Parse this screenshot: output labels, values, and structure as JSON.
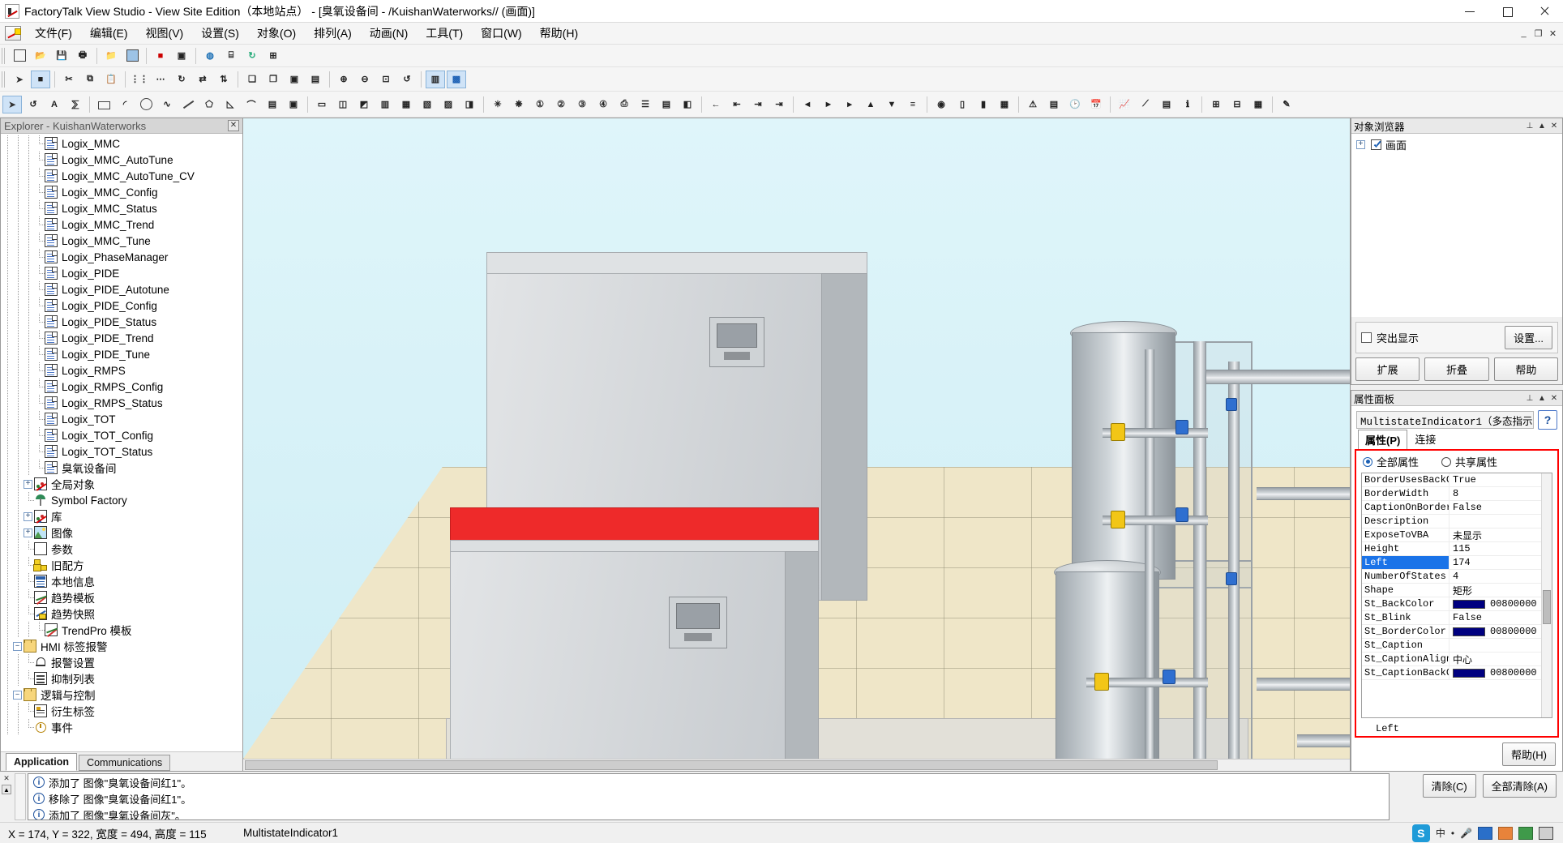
{
  "window": {
    "title": "FactoryTalk View Studio - View Site Edition（本地站点） - [臭氧设备间 - /KuishanWaterworks// (画面)]",
    "minimize": "–",
    "maximize": "□",
    "close": "✕"
  },
  "menu": {
    "items": [
      {
        "label": "文件(F)"
      },
      {
        "label": "编辑(E)"
      },
      {
        "label": "视图(V)"
      },
      {
        "label": "设置(S)"
      },
      {
        "label": "对象(O)"
      },
      {
        "label": "排列(A)"
      },
      {
        "label": "动画(N)"
      },
      {
        "label": "工具(T)"
      },
      {
        "label": "窗口(W)"
      },
      {
        "label": "帮助(H)"
      }
    ],
    "mdi": {
      "minimize": "_",
      "restore": "❐",
      "close": "✕"
    }
  },
  "toolbar_row1": [
    {
      "name": "new-display",
      "glyph": "▤"
    },
    {
      "name": "open-display",
      "glyph": "📂"
    },
    {
      "name": "save-display",
      "glyph": "💾"
    },
    {
      "name": "print",
      "glyph": "🖨"
    },
    {
      "name": "open-folder",
      "glyph": "📁"
    },
    {
      "name": "display-settings",
      "glyph": "▦"
    },
    {
      "name": "stop-test",
      "glyph": "■"
    },
    {
      "name": "test-run",
      "glyph": "▶"
    },
    {
      "name": "web-link",
      "glyph": "◍"
    },
    {
      "name": "tag-browser",
      "glyph": "⌸"
    },
    {
      "name": "refresh",
      "glyph": "↻"
    },
    {
      "name": "diagnostics",
      "glyph": "⊞"
    }
  ],
  "toolbar_row2": [
    {
      "name": "pointer-tool",
      "glyph": "➤"
    },
    {
      "name": "select-mode",
      "glyph": "■"
    },
    {
      "name": "cut",
      "glyph": "✂"
    },
    {
      "name": "copy",
      "glyph": "⧉"
    },
    {
      "name": "paste",
      "glyph": "📋"
    },
    {
      "name": "duplicate",
      "glyph": "⧉"
    },
    {
      "name": "align-grid",
      "glyph": "⋮⋮"
    },
    {
      "name": "snap-grid",
      "glyph": "⋯"
    },
    {
      "name": "rotate",
      "glyph": "↻"
    },
    {
      "name": "flip-horizontal",
      "glyph": "⇄"
    },
    {
      "name": "flip-vertical",
      "glyph": "⇅"
    },
    {
      "name": "group",
      "glyph": "❏"
    },
    {
      "name": "ungroup",
      "glyph": "❏"
    },
    {
      "name": "bring-front",
      "glyph": "▣"
    },
    {
      "name": "send-back",
      "glyph": "▤"
    },
    {
      "name": "zoom-in",
      "glyph": "⊕"
    },
    {
      "name": "zoom-out",
      "glyph": "⊖"
    },
    {
      "name": "zoom-fit",
      "glyph": "⊡"
    },
    {
      "name": "undo-arrange",
      "glyph": "↺"
    },
    {
      "name": "object-explorer",
      "glyph": "▥"
    },
    {
      "name": "property-panel",
      "glyph": "▩"
    }
  ],
  "toolbar_row3": [
    {
      "name": "select-arrow-tool",
      "glyph": "➤"
    },
    {
      "name": "rotate-tool",
      "glyph": "↺"
    },
    {
      "name": "text-tool",
      "glyph": "A"
    },
    {
      "name": "numeric-tool",
      "glyph": "⅀"
    },
    {
      "name": "rectangle-tool",
      "glyph": "▭"
    },
    {
      "name": "arc-tool",
      "glyph": "◜"
    },
    {
      "name": "ellipse-tool",
      "glyph": "◯"
    },
    {
      "name": "freehand-tool",
      "glyph": "∿"
    },
    {
      "name": "line-tool",
      "glyph": "╲"
    },
    {
      "name": "polygon-tool",
      "glyph": "⬠"
    },
    {
      "name": "wedge-tool",
      "glyph": "◺"
    },
    {
      "name": "polyline-tool",
      "glyph": "⌒"
    },
    {
      "name": "panel-tool",
      "glyph": "▤"
    },
    {
      "name": "image-tool",
      "glyph": "▣"
    },
    {
      "name": "button-tool",
      "glyph": "▭"
    },
    {
      "name": "toggle-tool",
      "glyph": "◫"
    },
    {
      "name": "multistate-tool",
      "glyph": "◩"
    },
    {
      "name": "latched-button",
      "glyph": "▥"
    },
    {
      "name": "interlock-button",
      "glyph": "▦"
    },
    {
      "name": "goto-display",
      "glyph": "▧"
    },
    {
      "name": "close-display",
      "glyph": "▨"
    },
    {
      "name": "ramp-tool",
      "glyph": "◨"
    },
    {
      "name": "indicator-tool",
      "glyph": "✳"
    },
    {
      "name": "symbol-tool",
      "glyph": "❋"
    },
    {
      "name": "numeric-display",
      "glyph": "1⃞"
    },
    {
      "name": "numeric-input",
      "glyph": "2⃞"
    },
    {
      "name": "string-display",
      "glyph": "3⃞"
    },
    {
      "name": "string-input",
      "glyph": "4⃞"
    },
    {
      "name": "recipe-tool",
      "glyph": "⎙"
    },
    {
      "name": "control-list",
      "glyph": "☰"
    },
    {
      "name": "piloted-list",
      "glyph": "▤"
    },
    {
      "name": "macro-button",
      "glyph": "◧"
    },
    {
      "name": "arrow-left",
      "glyph": "←"
    },
    {
      "name": "arrow-down-stop",
      "glyph": "⇤"
    },
    {
      "name": "arrow-up-stop",
      "glyph": "⇥"
    },
    {
      "name": "arrow-right-end",
      "glyph": "⇥"
    },
    {
      "name": "nav-prev",
      "glyph": "◄"
    },
    {
      "name": "nav-play",
      "glyph": "►"
    },
    {
      "name": "nav-next",
      "glyph": "▸"
    },
    {
      "name": "align-top",
      "glyph": "▲"
    },
    {
      "name": "align-bottom",
      "glyph": "▼"
    },
    {
      "name": "align-center",
      "glyph": "≡"
    },
    {
      "name": "gauge-tool",
      "glyph": "◉"
    },
    {
      "name": "slider-tool",
      "glyph": "▯"
    },
    {
      "name": "bar-graph",
      "glyph": "▮"
    },
    {
      "name": "scale-tool",
      "glyph": "▦"
    },
    {
      "name": "alarm-banner",
      "glyph": "⚠"
    },
    {
      "name": "alarm-list",
      "glyph": "▤"
    },
    {
      "name": "time-display",
      "glyph": "🕑"
    },
    {
      "name": "date-display",
      "glyph": "📅"
    },
    {
      "name": "trend-tool",
      "glyph": "📈"
    },
    {
      "name": "xy-plot",
      "glyph": "⟋"
    },
    {
      "name": "diagnostic-list",
      "glyph": "▤"
    },
    {
      "name": "information-msg",
      "glyph": "ℹ"
    },
    {
      "name": "activex-tool",
      "glyph": "⊞"
    },
    {
      "name": "ole-tool",
      "glyph": "⊟"
    },
    {
      "name": "grid-settings",
      "glyph": "▦"
    },
    {
      "name": "eyedropper",
      "glyph": "✎"
    }
  ],
  "explorer": {
    "title": "Explorer - KuishanWaterworks",
    "close": "✕",
    "items": [
      {
        "label": "Logix_MMC",
        "icon": "doc-icon",
        "level": 3,
        "expander": null
      },
      {
        "label": "Logix_MMC_AutoTune",
        "icon": "doc-icon",
        "level": 3,
        "expander": null
      },
      {
        "label": "Logix_MMC_AutoTune_CV",
        "icon": "doc-icon",
        "level": 3,
        "expander": null
      },
      {
        "label": "Logix_MMC_Config",
        "icon": "doc-icon",
        "level": 3,
        "expander": null
      },
      {
        "label": "Logix_MMC_Status",
        "icon": "doc-icon",
        "level": 3,
        "expander": null
      },
      {
        "label": "Logix_MMC_Trend",
        "icon": "doc-icon",
        "level": 3,
        "expander": null
      },
      {
        "label": "Logix_MMC_Tune",
        "icon": "doc-icon",
        "level": 3,
        "expander": null
      },
      {
        "label": "Logix_PhaseManager",
        "icon": "doc-icon",
        "level": 3,
        "expander": null
      },
      {
        "label": "Logix_PIDE",
        "icon": "doc-icon",
        "level": 3,
        "expander": null
      },
      {
        "label": "Logix_PIDE_Autotune",
        "icon": "doc-icon",
        "level": 3,
        "expander": null
      },
      {
        "label": "Logix_PIDE_Config",
        "icon": "doc-icon",
        "level": 3,
        "expander": null
      },
      {
        "label": "Logix_PIDE_Status",
        "icon": "doc-icon",
        "level": 3,
        "expander": null
      },
      {
        "label": "Logix_PIDE_Trend",
        "icon": "doc-icon",
        "level": 3,
        "expander": null
      },
      {
        "label": "Logix_PIDE_Tune",
        "icon": "doc-icon",
        "level": 3,
        "expander": null
      },
      {
        "label": "Logix_RMPS",
        "icon": "doc-icon",
        "level": 3,
        "expander": null
      },
      {
        "label": "Logix_RMPS_Config",
        "icon": "doc-icon",
        "level": 3,
        "expander": null
      },
      {
        "label": "Logix_RMPS_Status",
        "icon": "doc-icon",
        "level": 3,
        "expander": null
      },
      {
        "label": "Logix_TOT",
        "icon": "doc-icon",
        "level": 3,
        "expander": null
      },
      {
        "label": "Logix_TOT_Config",
        "icon": "doc-icon",
        "level": 3,
        "expander": null
      },
      {
        "label": "Logix_TOT_Status",
        "icon": "doc-icon",
        "level": 3,
        "expander": null
      },
      {
        "label": "臭氧设备间",
        "icon": "doc-icon",
        "level": 3,
        "expander": null
      },
      {
        "label": "全局对象",
        "icon": "palette-icon",
        "level": 2,
        "expander": "+"
      },
      {
        "label": "Symbol Factory",
        "icon": "symbol-factory-icon",
        "level": 2,
        "expander": null
      },
      {
        "label": "库",
        "icon": "palette-icon",
        "level": 2,
        "expander": "+"
      },
      {
        "label": "图像",
        "icon": "image-icon",
        "level": 2,
        "expander": "+"
      },
      {
        "label": "参数",
        "icon": "parameter-icon",
        "level": 2,
        "expander": null
      },
      {
        "label": "旧配方",
        "icon": "recipe-icon",
        "level": 2,
        "expander": null
      },
      {
        "label": "本地信息",
        "icon": "local-info-icon",
        "level": 2,
        "expander": null
      },
      {
        "label": "趋势模板",
        "icon": "trend-template-icon",
        "level": 2,
        "expander": null
      },
      {
        "label": "趋势快照",
        "icon": "trend-snapshot-icon",
        "level": 2,
        "expander": null
      },
      {
        "label": "TrendPro 模板",
        "icon": "trend-template-icon",
        "level": 3,
        "expander": null
      },
      {
        "label": "HMI 标签报警",
        "icon": "folder-icon",
        "level": 1,
        "expander": "–"
      },
      {
        "label": "报警设置",
        "icon": "alarm-bell-icon",
        "level": 2,
        "expander": null
      },
      {
        "label": "抑制列表",
        "icon": "list-icon",
        "level": 2,
        "expander": null
      },
      {
        "label": "逻辑与控制",
        "icon": "folder-icon",
        "level": 1,
        "expander": "–"
      },
      {
        "label": "衍生标签",
        "icon": "derived-tag-icon",
        "level": 2,
        "expander": null
      },
      {
        "label": "事件",
        "icon": "event-icon",
        "level": 2,
        "expander": null
      }
    ],
    "tabs": [
      {
        "label": "Application",
        "active": true
      },
      {
        "label": "Communications",
        "active": false
      }
    ]
  },
  "object_browser": {
    "title": "对象浏览器",
    "pin": "⊥",
    "collapse": "▲",
    "close": "✕",
    "root_item": "画面",
    "root_expander": "+",
    "highlight_label": "突出显示",
    "settings_button": "设置...",
    "buttons": [
      "扩展",
      "折叠",
      "帮助"
    ]
  },
  "property_panel": {
    "title": "属性面板",
    "pin": "⊥",
    "collapse": "▲",
    "close": "✕",
    "object_name": "MultistateIndicator1（多态指示",
    "help_button": "?",
    "tabs": [
      {
        "label": "属性(P)",
        "active": true
      },
      {
        "label": "连接",
        "active": false
      }
    ],
    "radios": [
      {
        "label": "全部属性",
        "selected": true
      },
      {
        "label": "共享属性",
        "selected": false
      }
    ],
    "rows": [
      {
        "key": "BorderUsesBackC",
        "value": "True",
        "swatch": null,
        "selected": false
      },
      {
        "key": "BorderWidth",
        "value": "8",
        "swatch": null,
        "selected": false
      },
      {
        "key": "CaptionOnBorder",
        "value": "False",
        "swatch": null,
        "selected": false
      },
      {
        "key": "Description",
        "value": "",
        "swatch": null,
        "selected": false
      },
      {
        "key": "ExposeToVBA",
        "value": "未显示",
        "swatch": null,
        "selected": false
      },
      {
        "key": "Height",
        "value": "115",
        "swatch": null,
        "selected": false
      },
      {
        "key": "Left",
        "value": "174",
        "swatch": null,
        "selected": true
      },
      {
        "key": "NumberOfStates",
        "value": "4",
        "swatch": null,
        "selected": false
      },
      {
        "key": "Shape",
        "value": "矩形",
        "swatch": null,
        "selected": false
      },
      {
        "key": "St_BackColor",
        "value": "00800000",
        "swatch": "#000080",
        "selected": false
      },
      {
        "key": "St_Blink",
        "value": "False",
        "swatch": null,
        "selected": false
      },
      {
        "key": "St_BorderColor",
        "value": "00800000",
        "swatch": "#000080",
        "selected": false
      },
      {
        "key": "St_Caption",
        "value": "",
        "swatch": null,
        "selected": false
      },
      {
        "key": "St_CaptionAlign",
        "value": "中心",
        "swatch": null,
        "selected": false
      },
      {
        "key": "St_CaptionBackC",
        "value": "00800000",
        "swatch": "#000080",
        "selected": false
      }
    ],
    "status_text": "Left",
    "help_footer_button": "帮助(H)"
  },
  "log": {
    "close": "✕",
    "scroll_up": "▲",
    "messages": [
      {
        "icon": "info-icon",
        "text": "添加了 图像\"臭氧设备间红1\"。"
      },
      {
        "icon": "info-icon",
        "text": "移除了 图像\"臭氧设备间红1\"。"
      },
      {
        "icon": "info-icon",
        "text": "添加了 图像\"臭氧设备间灰\"。"
      }
    ],
    "clear_button": "清除(C)",
    "clear_all_button": "全部清除(A)"
  },
  "status_bar": {
    "coords": "X = 174, Y = 322, 宽度 = 494, 高度 = 115",
    "object": "MultistateIndicator1",
    "tray": [
      {
        "name": "sogou-ime-icon",
        "label": "S"
      },
      {
        "name": "ime-chinese-icon",
        "label": "中"
      },
      {
        "name": "ime-halfwidth-icon",
        "label": "•"
      },
      {
        "name": "ime-microphone-icon",
        "label": "🎤"
      },
      {
        "name": "ime-keyboard-icon",
        "label": "⌨"
      },
      {
        "name": "ime-toolbox-icon",
        "label": "🧰"
      },
      {
        "name": "ime-skin-icon",
        "label": "◧"
      },
      {
        "name": "ime-menu-icon",
        "label": "≡"
      }
    ]
  },
  "canvas": {
    "scene_name": "臭氧设备间",
    "zoom_scroll": true
  }
}
